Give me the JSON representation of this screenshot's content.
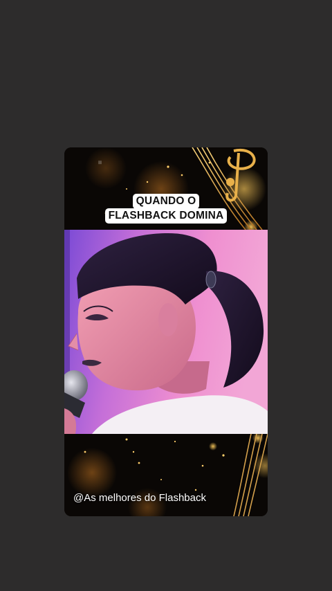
{
  "caption": {
    "line1": "QUANDO O",
    "line2": "FLASHBACK DOMINA"
  },
  "watermark": {
    "text": "@As melhores do Flashback"
  },
  "decor": {
    "top_icon": "music-note-icon",
    "bottom_icon": "music-staff-icon",
    "accent_color": "#e0a040"
  },
  "video": {
    "subject": "singer-with-microphone-image"
  }
}
